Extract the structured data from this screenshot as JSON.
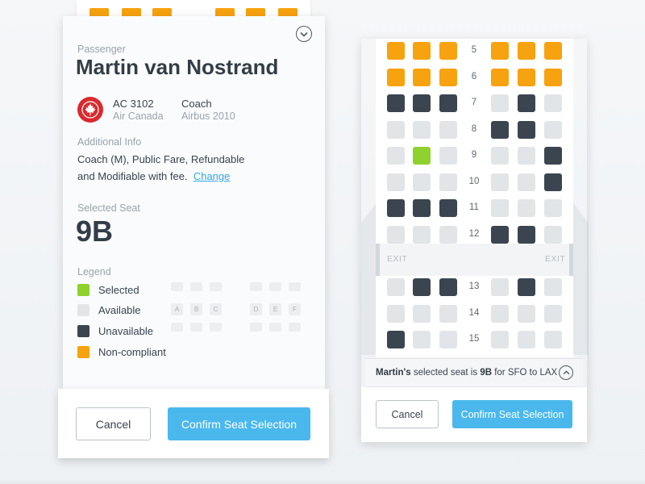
{
  "colors": {
    "selected": "#8fd12e",
    "available": "#e2e5e8",
    "unavailable": "#3b4550",
    "noncompliant": "#f7a20f",
    "accent": "#4ab8ec",
    "link": "#35a7e6"
  },
  "details": {
    "passenger_label": "Passenger",
    "passenger_name": "Martin van Nostrand",
    "collapse_icon": "chevron-down-circle-icon",
    "airline_logo": "maple-leaf-logo",
    "flight_number": "AC 3102",
    "airline": "Air Canada",
    "cabin": "Coach",
    "aircraft": "Airbus 2010",
    "additional_info_label": "Additional Info",
    "additional_info_text": "Coach (M), Public Fare, Refundable and Modifiable with fee.",
    "change_link": "Change",
    "selected_seat_label": "Selected Seat",
    "selected_seat": "9B",
    "legend_label": "Legend",
    "legend": [
      {
        "label": "Selected",
        "status": "selected"
      },
      {
        "label": "Available",
        "status": "available"
      },
      {
        "label": "Unavailable",
        "status": "unavailable"
      },
      {
        "label": "Non-compliant",
        "status": "noncompliant"
      }
    ],
    "mini_columns": [
      "A",
      "B",
      "C",
      "D",
      "E",
      "F"
    ]
  },
  "left_footer": {
    "cancel": "Cancel",
    "confirm": "Confirm Seat Selection"
  },
  "seat_map": {
    "columns": [
      "A",
      "B",
      "C",
      "D",
      "E",
      "F"
    ],
    "exit_label": "EXIT",
    "exit_after_row": "12",
    "rows": [
      {
        "number": "5",
        "seats": [
          "noncompliant",
          "noncompliant",
          "noncompliant",
          "noncompliant",
          "noncompliant",
          "noncompliant"
        ]
      },
      {
        "number": "6",
        "seats": [
          "noncompliant",
          "noncompliant",
          "noncompliant",
          "noncompliant",
          "noncompliant",
          "noncompliant"
        ]
      },
      {
        "number": "7",
        "seats": [
          "unavailable",
          "unavailable",
          "unavailable",
          "available",
          "unavailable",
          "available"
        ]
      },
      {
        "number": "8",
        "seats": [
          "available",
          "available",
          "available",
          "unavailable",
          "unavailable",
          "available"
        ]
      },
      {
        "number": "9",
        "seats": [
          "available",
          "selected",
          "available",
          "available",
          "available",
          "unavailable"
        ]
      },
      {
        "number": "10",
        "seats": [
          "available",
          "available",
          "available",
          "available",
          "available",
          "unavailable"
        ]
      },
      {
        "number": "11",
        "seats": [
          "unavailable",
          "unavailable",
          "unavailable",
          "available",
          "available",
          "available"
        ]
      },
      {
        "number": "12",
        "seats": [
          "available",
          "available",
          "available",
          "unavailable",
          "unavailable",
          "available"
        ]
      },
      {
        "number": "13",
        "seats": [
          "available",
          "unavailable",
          "unavailable",
          "available",
          "unavailable",
          "available"
        ]
      },
      {
        "number": "14",
        "seats": [
          "available",
          "available",
          "available",
          "available",
          "available",
          "available"
        ]
      },
      {
        "number": "15",
        "seats": [
          "unavailable",
          "available",
          "available",
          "available",
          "available",
          "available"
        ]
      }
    ]
  },
  "summary": {
    "name": "Martin's",
    "middle": "selected seat is",
    "seat": "9B",
    "route": "for SFO to LAX",
    "expand_icon": "chevron-up-circle-icon"
  },
  "right_footer": {
    "cancel": "Cancel",
    "confirm": "Confirm Seat Selection"
  }
}
